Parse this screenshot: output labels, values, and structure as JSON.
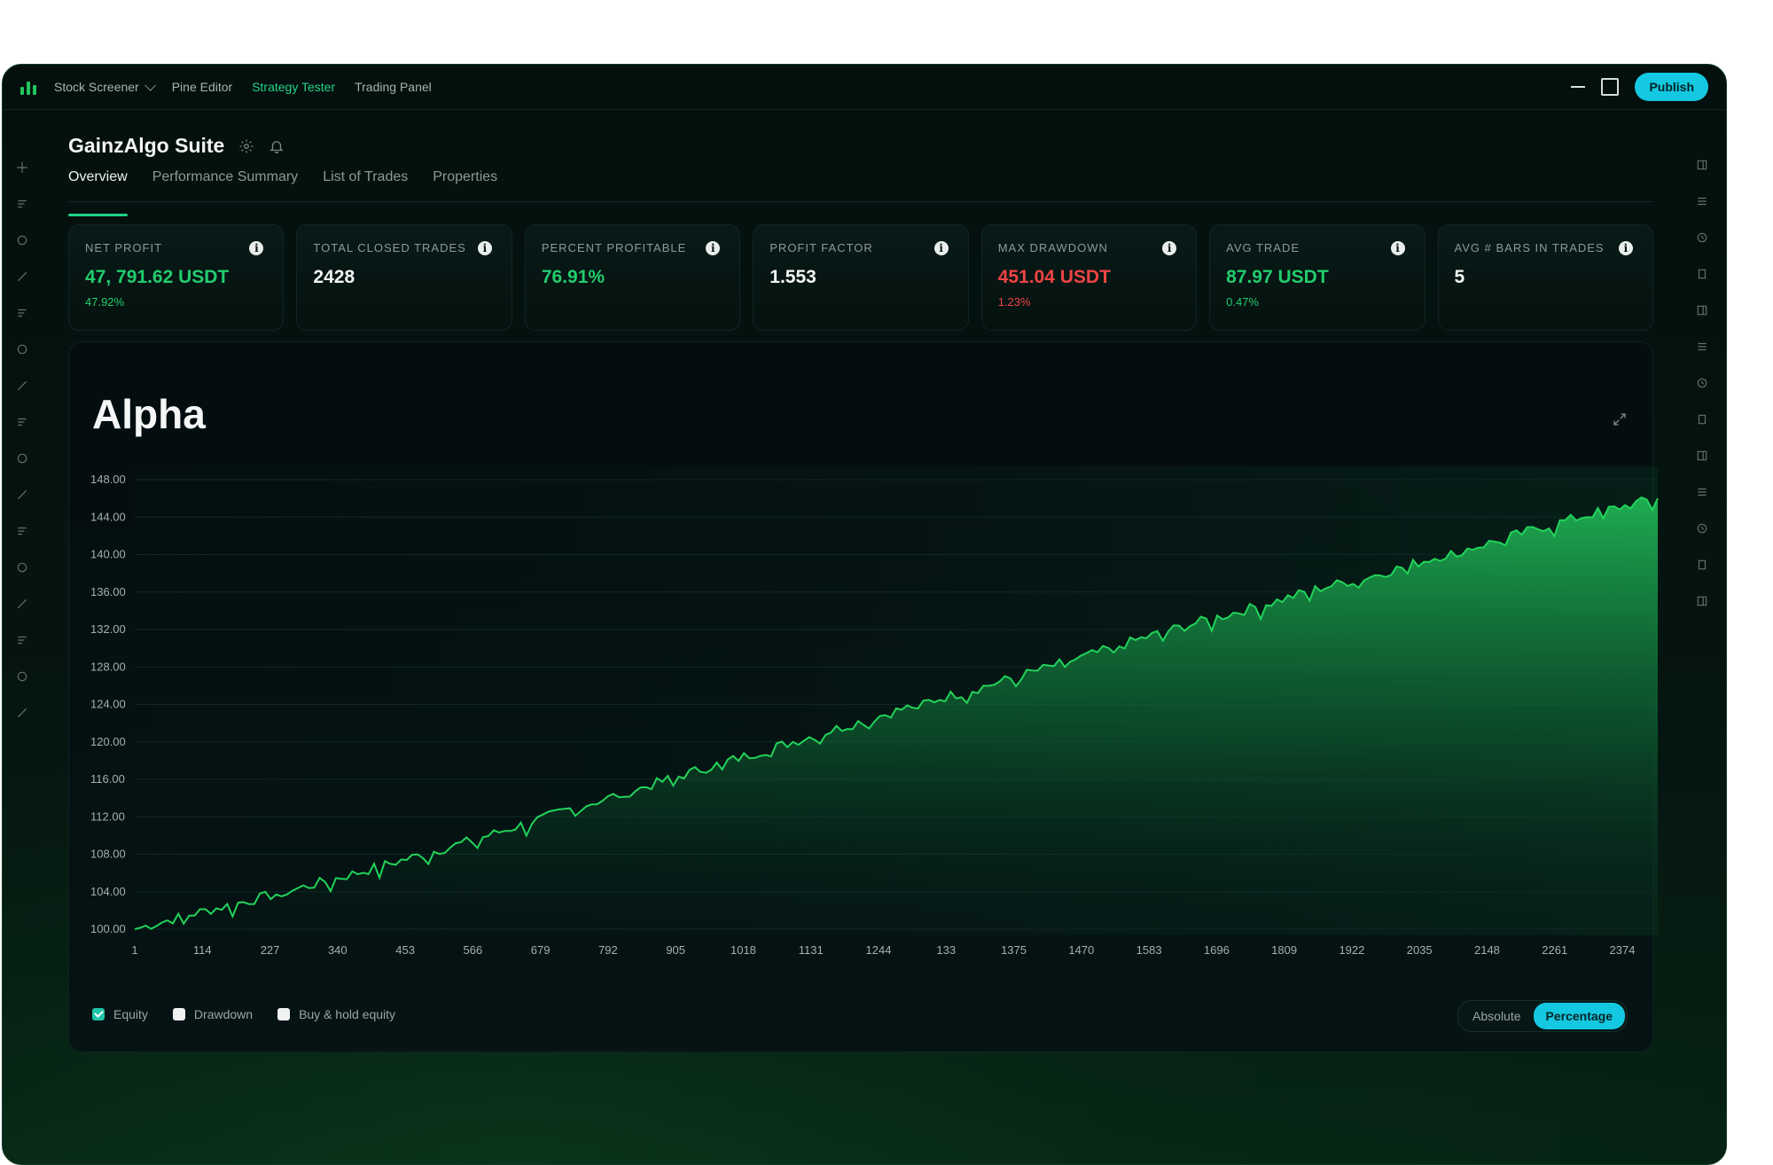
{
  "topbar": {
    "menu": [
      "Stock Screener",
      "Pine Editor",
      "Strategy Tester",
      "Trading Panel"
    ],
    "active_menu": "Strategy Tester",
    "publish_label": "Publish"
  },
  "page": {
    "title": "GainzAlgo Suite",
    "tabs": [
      "Overview",
      "Performance Summary",
      "List of Trades",
      "Properties"
    ],
    "active_tab": "Overview"
  },
  "stats": [
    {
      "label": "NET PROFIT",
      "value": "47, 791.62 USDT",
      "sub": "47.92%",
      "tone": "green"
    },
    {
      "label": "TOTAL CLOSED TRADES",
      "value": "2428",
      "sub": "",
      "tone": "white"
    },
    {
      "label": "PERCENT PROFITABLE",
      "value": "76.91%",
      "sub": "",
      "tone": "green"
    },
    {
      "label": "PROFIT FACTOR",
      "value": "1.553",
      "sub": "",
      "tone": "white"
    },
    {
      "label": "MAX DRAWDOWN",
      "value": "451.04 USDT",
      "sub": "1.23%",
      "tone": "red"
    },
    {
      "label": "AVG TRADE",
      "value": "87.97 USDT",
      "sub": "0.47%",
      "tone": "green"
    },
    {
      "label": "AVG # BARS IN TRADES",
      "value": "5",
      "sub": "",
      "tone": "white"
    }
  ],
  "chart_data": {
    "type": "area",
    "title": "Alpha",
    "y_ticks": [
      "148.00",
      "144.00",
      "140.00",
      "136.00",
      "132.00",
      "128.00",
      "124.00",
      "120.00",
      "116.00",
      "112.00",
      "108.00",
      "104.00",
      "100.00"
    ],
    "ylim": [
      100,
      148
    ],
    "x_ticks": [
      "1",
      "114",
      "227",
      "340",
      "453",
      "566",
      "679",
      "792",
      "905",
      "1018",
      "1131",
      "1244",
      "133",
      "1375",
      "1470",
      "1583",
      "1696",
      "1809",
      "1922",
      "2035",
      "2148",
      "2261",
      "2374"
    ],
    "series": [
      {
        "values": [
          100.0,
          101.6,
          103.0,
          104.5,
          106.1,
          107.8,
          109.5,
          111.4,
          113.3,
          115.1,
          117.0,
          118.8,
          120.6,
          122.4,
          124.2,
          125.8,
          127.6,
          129.4,
          131.3,
          133.0,
          134.6,
          136.4,
          137.8,
          139.6,
          141.2,
          143.0,
          144.6,
          146.0
        ]
      }
    ],
    "grid": true,
    "line_color": "#22d35a"
  },
  "legend": [
    {
      "label": "Equity",
      "checked": true
    },
    {
      "label": "Drawdown",
      "checked": false
    },
    {
      "label": "Buy & hold equity",
      "checked": false
    }
  ],
  "toggle": {
    "options": [
      "Absolute",
      "Percentage"
    ],
    "active": "Percentage"
  },
  "icons": {
    "left_toolbar": [
      "crosshair-icon",
      "trend-line-icon",
      "horizontal-lines-icon",
      "fork-icon",
      "filter-lines-icon",
      "brush-icon",
      "text-icon",
      "emoji-icon",
      "ruler-icon",
      "zoom-icon",
      "magnet-icon",
      "pencil-icon",
      "lock-icon",
      "eye-icon",
      "link-icon",
      "trash-icon"
    ],
    "right_toolbar": [
      "panel-icon",
      "list-icon",
      "clock-icon",
      "image-icon",
      "lightbulb-icon",
      "calendar-icon",
      "user-icon",
      "chat-icon",
      "broadcast-icon",
      "play-icon",
      "bell-icon",
      "layers-icon",
      "help-icon"
    ]
  },
  "colors": {
    "accent": "#22d38a",
    "publish": "#13c8e0",
    "profit": "#22cc6e",
    "loss": "#ef4444"
  }
}
